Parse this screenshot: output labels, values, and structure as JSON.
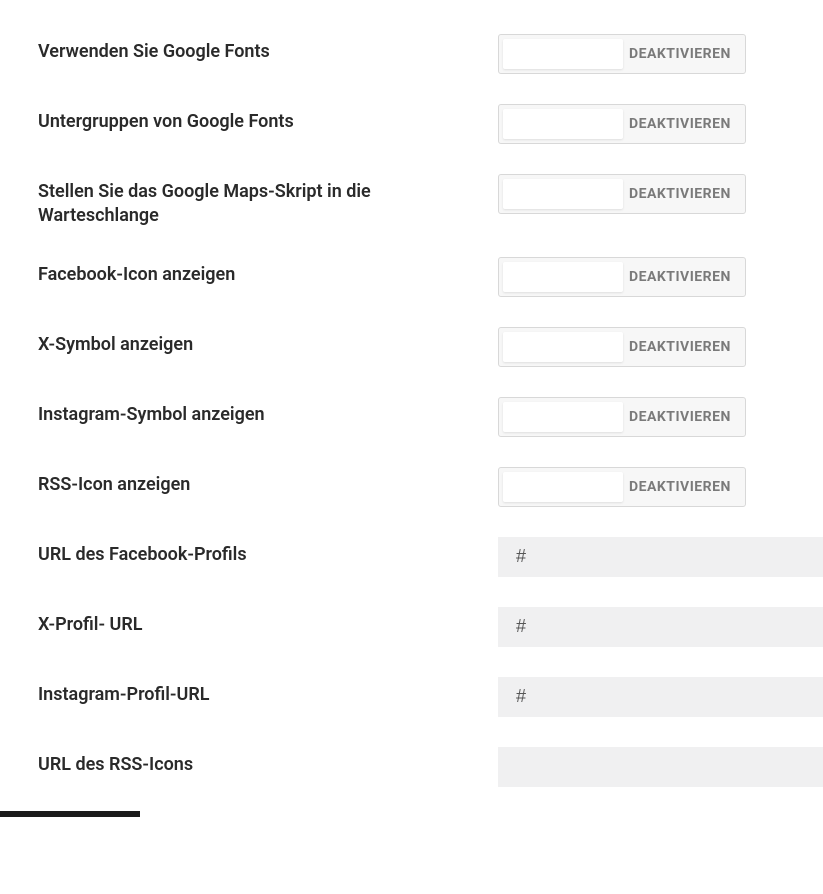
{
  "settings": [
    {
      "key": "google_fonts",
      "label": "Verwenden Sie Google Fonts",
      "type": "toggle",
      "status": "DEAKTIVIEREN"
    },
    {
      "key": "google_fonts_subgroups",
      "label": "Untergruppen von Google Fonts",
      "type": "toggle",
      "status": "DEAKTIVIEREN"
    },
    {
      "key": "google_maps_script",
      "label": "Stellen Sie das Google Maps-Skript in die Warteschlange",
      "type": "toggle",
      "status": "DEAKTIVIEREN"
    },
    {
      "key": "facebook_icon",
      "label": "Facebook-Icon anzeigen",
      "type": "toggle",
      "status": "DEAKTIVIEREN"
    },
    {
      "key": "x_symbol",
      "label": "X-Symbol anzeigen",
      "type": "toggle",
      "status": "DEAKTIVIEREN"
    },
    {
      "key": "instagram_symbol",
      "label": "Instagram-Symbol anzeigen",
      "type": "toggle",
      "status": "DEAKTIVIEREN"
    },
    {
      "key": "rss_icon",
      "label": "RSS-Icon anzeigen",
      "type": "toggle",
      "status": "DEAKTIVIEREN"
    },
    {
      "key": "facebook_url",
      "label": "URL des Facebook-Profils",
      "type": "input",
      "value": "#"
    },
    {
      "key": "x_url",
      "label": "X-Profil- URL",
      "type": "input",
      "value": "#"
    },
    {
      "key": "instagram_url",
      "label": "Instagram-Profil-URL",
      "type": "input",
      "value": "#"
    },
    {
      "key": "rss_url",
      "label": "URL des RSS-Icons",
      "type": "input",
      "value": ""
    }
  ]
}
